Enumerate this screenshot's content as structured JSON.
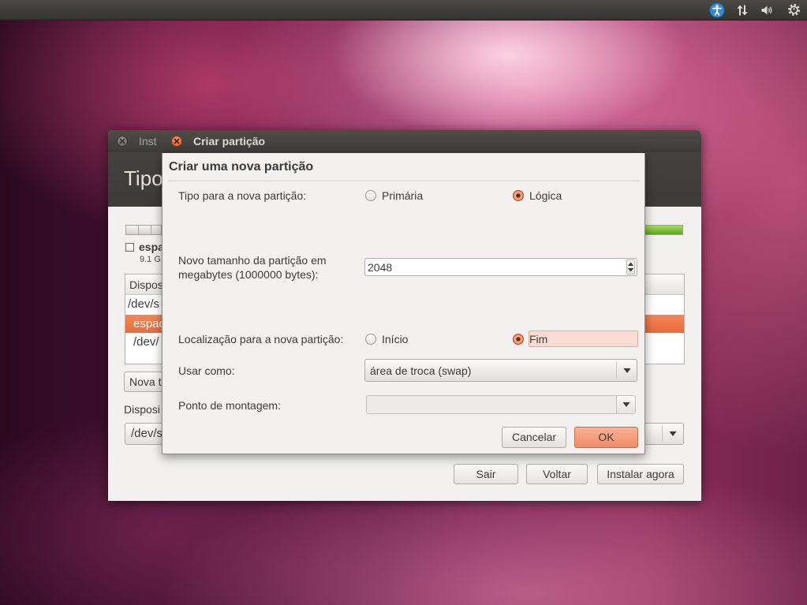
{
  "colors": {
    "accent": "#f07746",
    "panel": "#3c3b37",
    "window_bg": "#f2f1f0",
    "selection": "#f07746",
    "free_space": "#72bf2f",
    "focus_highlight": "#f9ddd3"
  },
  "top_panel": {
    "icons": [
      "accessibility-icon",
      "network-updown-icon",
      "volume-icon",
      "session-gear-icon"
    ]
  },
  "installer": {
    "window_title": "Inst",
    "page_title": "Tipo",
    "disk": {
      "checkbox_checked": false,
      "label": "espa",
      "size": "9.1 G"
    },
    "table": {
      "header": "Dispos",
      "rows": [
        {
          "text": "/dev/s",
          "selected": false
        },
        {
          "text": "espaç",
          "selected": true
        },
        {
          "text": "/dev/",
          "selected": false
        }
      ]
    },
    "new_table_button": "Nova t",
    "boot_device_label": "Disposi",
    "boot_device_value": "/dev/s",
    "buttons": {
      "quit": "Sair",
      "back": "Voltar",
      "install_now": "Instalar agora"
    }
  },
  "dialog": {
    "window_title": "Criar partição",
    "heading": "Criar uma nova partição",
    "type": {
      "label": "Tipo para a nova partição:",
      "options": [
        {
          "label": "Primária",
          "selected": false
        },
        {
          "label": "Lógica",
          "selected": true
        }
      ]
    },
    "size": {
      "label_lines": [
        "Novo tamanho da partição em",
        "megabytes (1000000 bytes):"
      ],
      "value": "2048"
    },
    "location": {
      "label": "Localização para a nova partição:",
      "options": [
        {
          "label": "Início",
          "selected": false,
          "focused": false
        },
        {
          "label": "Fim",
          "selected": true,
          "focused": true
        }
      ]
    },
    "use_as": {
      "label": "Usar como:",
      "value": "área de troca (swap)"
    },
    "mount_point": {
      "label": "Ponto de montagem:",
      "value": "",
      "enabled": false
    },
    "buttons": {
      "cancel": "Cancelar",
      "ok": "OK"
    }
  }
}
